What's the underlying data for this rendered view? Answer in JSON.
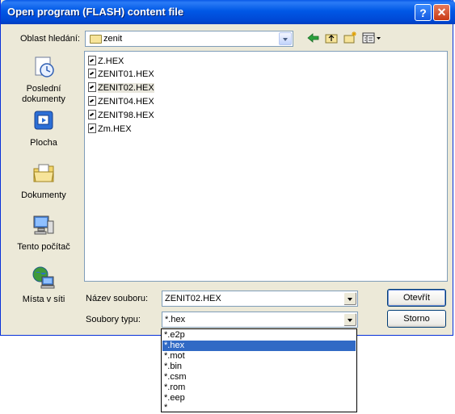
{
  "window": {
    "title": "Open program (FLASH) content file",
    "help_glyph": "?",
    "close_glyph": "✕"
  },
  "lookin": {
    "label": "Oblast hledání:",
    "value": "zenit"
  },
  "toolbar": {
    "back_icon": "back-arrow-icon",
    "up_icon": "up-folder-icon",
    "new_folder_icon": "new-folder-icon",
    "views_icon": "view-menu-icon"
  },
  "places": [
    {
      "label": "Poslední\ndokumenty",
      "icon": "recent-documents-icon"
    },
    {
      "label": "Plocha",
      "icon": "desktop-icon"
    },
    {
      "label": "Dokumenty",
      "icon": "my-documents-icon"
    },
    {
      "label": "Tento počítač",
      "icon": "my-computer-icon"
    },
    {
      "label": "Místa v síti",
      "icon": "network-places-icon"
    }
  ],
  "files": [
    {
      "name": "Z.HEX",
      "selected": false
    },
    {
      "name": "ZENIT01.HEX",
      "selected": false
    },
    {
      "name": "ZENIT02.HEX",
      "selected": true
    },
    {
      "name": "ZENIT04.HEX",
      "selected": false
    },
    {
      "name": "ZENIT98.HEX",
      "selected": false
    },
    {
      "name": "Zm.HEX",
      "selected": false
    }
  ],
  "filename": {
    "label": "Název souboru:",
    "value": "ZENIT02.HEX"
  },
  "filetype": {
    "label": "Soubory typu:",
    "value": "*.hex",
    "options": [
      "*.e2p",
      "*.hex",
      "*.mot",
      "*.bin",
      "*.csm",
      "*.rom",
      "*.eep",
      "*"
    ],
    "selected_index": 1
  },
  "buttons": {
    "open": "Otevřít",
    "cancel": "Storno"
  },
  "colors": {
    "titlebar": "#0058e6",
    "selection": "#316ac5",
    "dialog_bg": "#ece9d8"
  }
}
